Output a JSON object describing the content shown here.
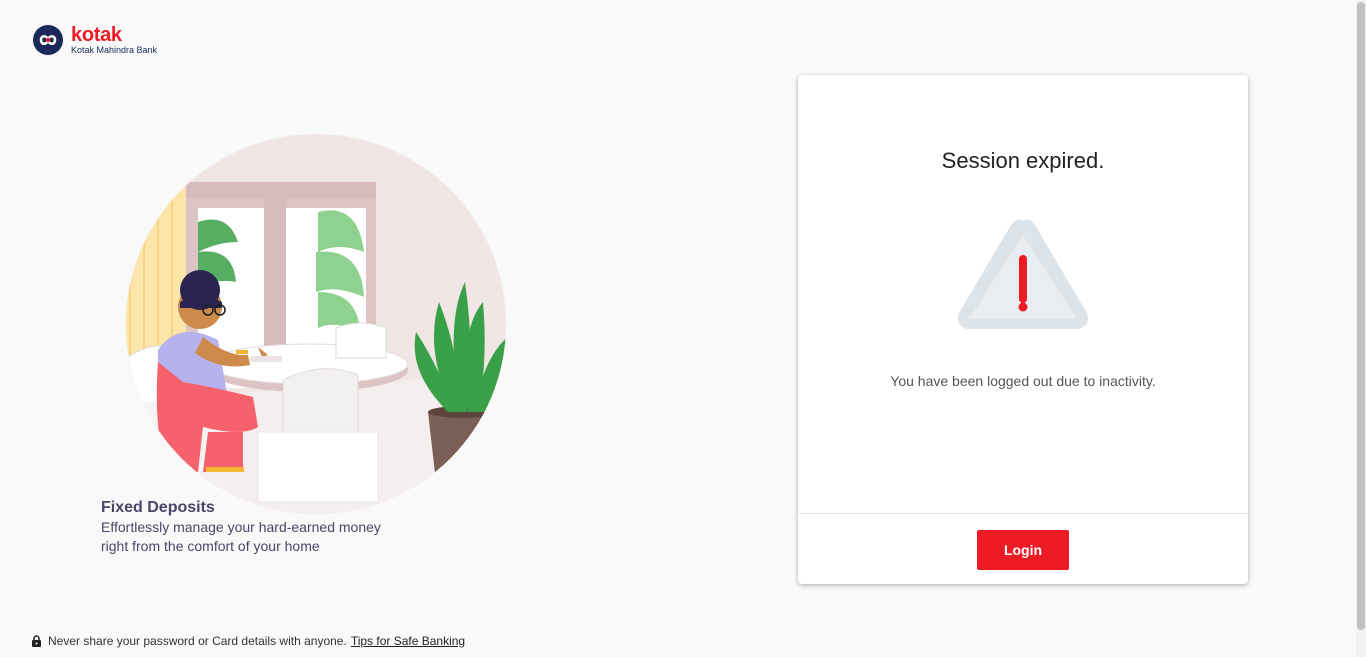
{
  "logo": {
    "brand": "kotak",
    "subtitle": "Kotak Mahindra Bank",
    "icon": "kotak-infinity-icon"
  },
  "promo": {
    "title": "Fixed Deposits",
    "description": "Effortlessly manage your hard-earned money right from the comfort of your home"
  },
  "card": {
    "title": "Session expired.",
    "message": "You have been logged out due to inactivity.",
    "icon": "warning-icon",
    "login_label": "Login"
  },
  "footer": {
    "notice": "Never share your password or Card details with anyone.",
    "link": "Tips for Safe Banking",
    "icon": "lock-icon"
  },
  "colors": {
    "accent": "#ed1c24",
    "brand_navy": "#1b2a5b",
    "promo_text": "#4a4569",
    "page_bg": "#f9f9f9"
  }
}
